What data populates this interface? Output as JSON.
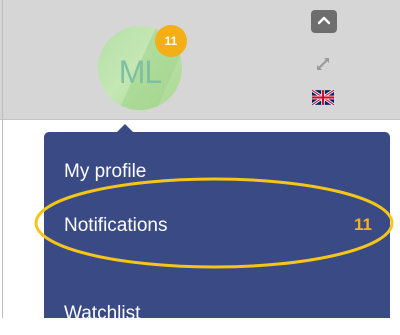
{
  "header": {
    "avatar_initials": "ML",
    "notification_count": "11",
    "collapse_icon": "chevron-up-icon",
    "expand_icon": "expand-arrows-icon",
    "language_flag": "uk-flag-icon"
  },
  "menu": {
    "items": [
      {
        "label": "My profile"
      },
      {
        "label": "Notifications",
        "count": "11"
      },
      {
        "label": "Watchlist"
      }
    ]
  },
  "colors": {
    "menu_background": "#3a4a84",
    "badge": "#f4ae16",
    "highlight_ellipse": "#f5c518"
  }
}
